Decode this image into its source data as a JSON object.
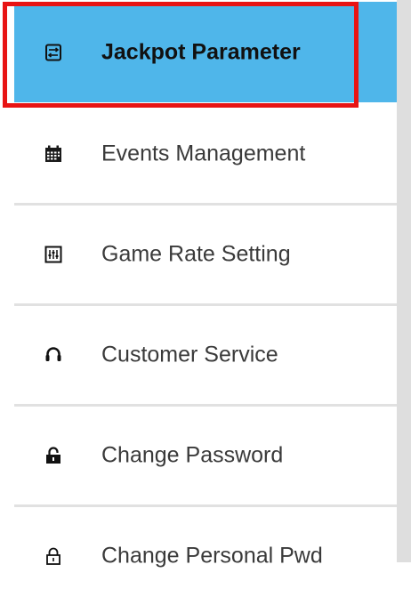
{
  "menu": {
    "items": [
      {
        "label": "Jackpot Parameter",
        "icon": "jackpot-settings-icon",
        "active": true
      },
      {
        "label": "Events Management",
        "icon": "calendar-icon",
        "active": false
      },
      {
        "label": "Game Rate Setting",
        "icon": "sliders-icon",
        "active": false
      },
      {
        "label": "Customer Service",
        "icon": "headset-icon",
        "active": false
      },
      {
        "label": "Change Password",
        "icon": "lock-icon",
        "active": false
      },
      {
        "label": "Change Personal Pwd",
        "icon": "unlock-icon",
        "active": false
      }
    ]
  },
  "colors": {
    "active_background": "#4fb6ea",
    "highlight_border": "#e81414",
    "divider": "#e1e1e1",
    "scrollbar": "#dedede"
  }
}
